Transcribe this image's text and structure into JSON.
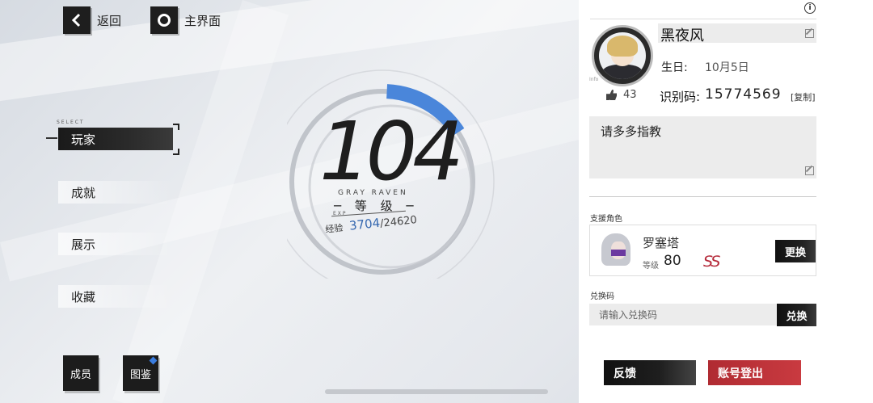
{
  "nav": {
    "back_label": "返回",
    "home_label": "主界面"
  },
  "menu": {
    "select_tag": "SELECT",
    "items": [
      {
        "label": "玩家"
      },
      {
        "label": "成就"
      },
      {
        "label": "展示"
      },
      {
        "label": "收藏"
      }
    ]
  },
  "bottom_buttons": {
    "members": "成员",
    "codex": "图鉴"
  },
  "level": {
    "value": "104",
    "subtitle": "GRAY RAVEN",
    "label": "─ 等 级 ─",
    "exp_tag": "EXP",
    "exp_label": "经验",
    "exp_current": "3704",
    "exp_max": "/24620",
    "exp_fraction": 0.15
  },
  "profile": {
    "info_icon": "i",
    "avatar_tag": "Info",
    "name": "黑夜风",
    "birthday_label": "生日:",
    "birthday": "10月5日",
    "likes": "43",
    "id_label": "识别码:",
    "id": "15774569",
    "copy_label": "[复制]",
    "intro": "请多多指教"
  },
  "support": {
    "section_label": "支援角色",
    "char_name": "罗塞塔",
    "level_label": "等级",
    "level": "80",
    "rank": "SS",
    "change_label": "更换"
  },
  "redeem": {
    "section_label": "兑换码",
    "placeholder": "请输入兑换码",
    "button_label": "兑换"
  },
  "footer": {
    "feedback_label": "反馈",
    "logout_label": "账号登出"
  },
  "colors": {
    "accent_blue": "#3a7de0",
    "logout_red": "#c0333a",
    "rank_red": "#b52a3a"
  }
}
